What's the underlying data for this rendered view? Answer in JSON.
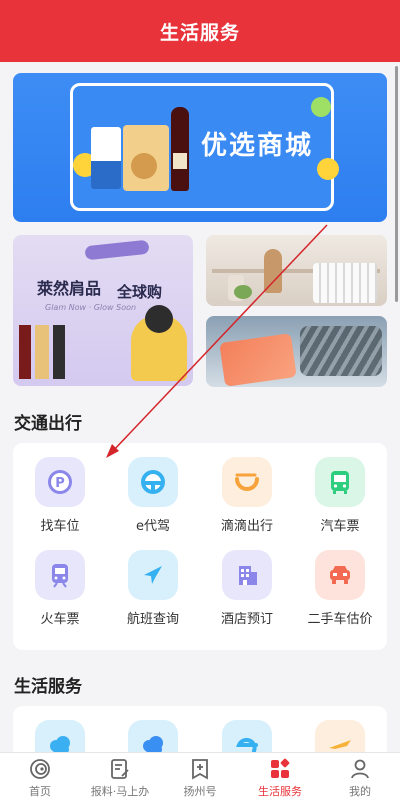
{
  "header": {
    "title": "生活服务"
  },
  "banner": {
    "title": "优选商城"
  },
  "promo_left": {
    "title_a": "萊然肩品",
    "title_b": "全球购",
    "subtitle": "Glam Now · Glow Soon"
  },
  "sections": {
    "transport": {
      "title": "交通出行",
      "items": [
        {
          "label": "找车位",
          "icon": "parking-icon",
          "color": "#8a86ea"
        },
        {
          "label": "e代驾",
          "icon": "steering-wheel-icon",
          "color": "#35b0f0"
        },
        {
          "label": "滴滴出行",
          "icon": "didi-icon",
          "color": "#f7a23a"
        },
        {
          "label": "汽车票",
          "icon": "bus-icon",
          "color": "#2fce7f"
        },
        {
          "label": "火车票",
          "icon": "train-icon",
          "color": "#8a86ea"
        },
        {
          "label": "航班查询",
          "icon": "airplane-icon",
          "color": "#35b0f0"
        },
        {
          "label": "酒店预订",
          "icon": "hotel-icon",
          "color": "#8a86ea"
        },
        {
          "label": "二手车估价",
          "icon": "car-icon",
          "color": "#f36a52"
        }
      ]
    },
    "life": {
      "title": "生活服务",
      "items": [
        {
          "icon": "cloud-icon",
          "color": "#3ab0f2"
        },
        {
          "icon": "cloud-icon",
          "color": "#3a8ff2"
        },
        {
          "icon": "e-logo-icon",
          "color": "#35b0f0"
        },
        {
          "icon": "plane-icon",
          "color": "#f7b23a"
        }
      ]
    }
  },
  "tabbar": [
    {
      "label": "首页",
      "icon": "home-icon",
      "active": false
    },
    {
      "label": "报料·马上办",
      "icon": "report-icon",
      "active": false
    },
    {
      "label": "扬州号",
      "icon": "subscribe-icon",
      "active": false
    },
    {
      "label": "生活服务",
      "icon": "services-icon",
      "active": true
    },
    {
      "label": "我的",
      "icon": "profile-icon",
      "active": false
    }
  ],
  "colors": {
    "brand": "#e8333a",
    "annotation": "#d4252b"
  }
}
